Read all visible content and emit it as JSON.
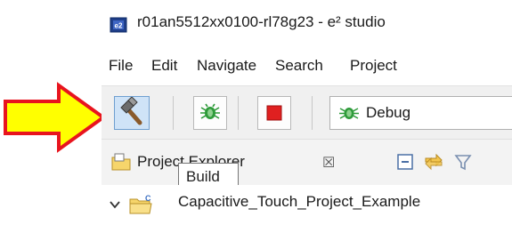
{
  "window": {
    "title": "r01an5512xx0100-rl78g23 - e² studio"
  },
  "menu": [
    "File",
    "Edit",
    "Navigate",
    "Search",
    "Project"
  ],
  "toolbar": {
    "launch_configuration": "Debug"
  },
  "tooltip": {
    "text": "Build"
  },
  "explorer": {
    "tab_label": "Project Explorer",
    "tree": [
      {
        "label": "Capacitive_Touch_Project_Example",
        "expanded": true
      }
    ]
  },
  "icons": {
    "app": "e2-studio-app-icon",
    "build": "hammer-icon",
    "debug": "bug-icon",
    "stop": "stop-icon",
    "callout": "yellow-arrow-pointing-right"
  },
  "colors": {
    "callout_fill": "#ffff00",
    "callout_outline": "#e8141e",
    "stop_red": "#e02020",
    "bug_green": "#2e9b3a",
    "build_highlight": "#cfe3f7"
  }
}
